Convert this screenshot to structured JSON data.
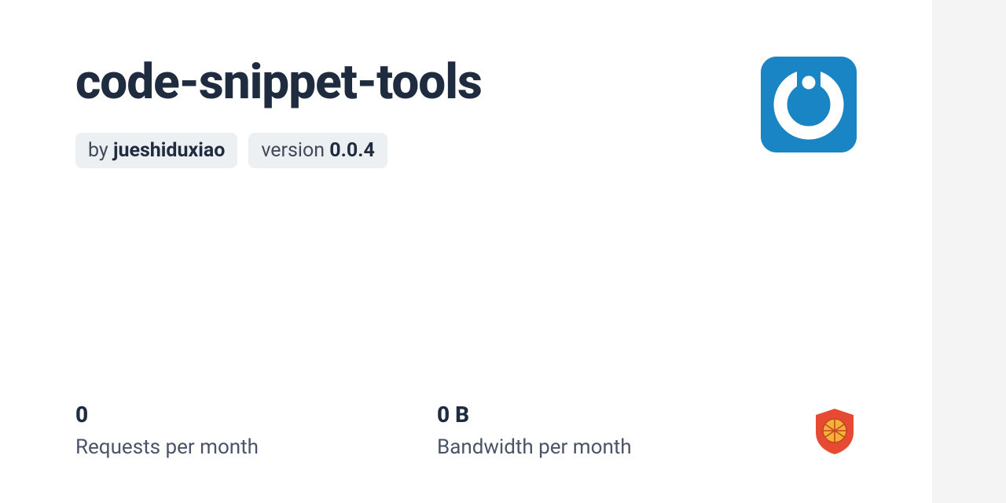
{
  "package": {
    "name": "code-snippet-tools",
    "author_prefix": "by ",
    "author": "jueshiduxiao",
    "version_prefix": "version ",
    "version": "0.0.4"
  },
  "stats": {
    "requests_value": "0",
    "requests_label": "Requests per month",
    "bandwidth_value": "0 B",
    "bandwidth_label": "Bandwidth per month"
  },
  "icons": {
    "avatar": "avatar-g-icon",
    "corner": "jsdelivr-shield-icon"
  }
}
